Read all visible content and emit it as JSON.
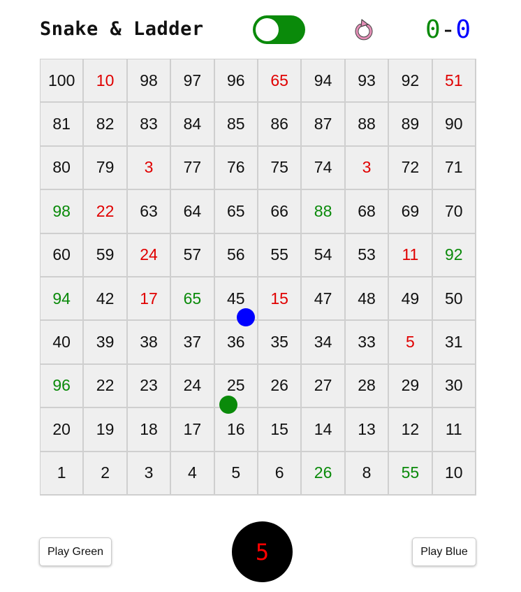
{
  "header": {
    "title": "Snake & Ladder",
    "toggle": {
      "state": "on",
      "color": "#0a8a0a"
    },
    "reset_icon": "refresh-icon",
    "score": {
      "green": "0",
      "separator": "-",
      "blue": "0"
    }
  },
  "colors": {
    "green": "#0a8a0a",
    "blue": "#0000ff",
    "snake": "#e00000",
    "dice_bg": "#000000",
    "dice_text": "#ff0000"
  },
  "board": {
    "rows": [
      [
        {
          "label": "100",
          "kind": "normal"
        },
        {
          "label": "10",
          "kind": "snake"
        },
        {
          "label": "98",
          "kind": "normal"
        },
        {
          "label": "97",
          "kind": "normal"
        },
        {
          "label": "96",
          "kind": "normal"
        },
        {
          "label": "65",
          "kind": "snake"
        },
        {
          "label": "94",
          "kind": "normal"
        },
        {
          "label": "93",
          "kind": "normal"
        },
        {
          "label": "92",
          "kind": "normal"
        },
        {
          "label": "51",
          "kind": "snake"
        }
      ],
      [
        {
          "label": "81",
          "kind": "normal"
        },
        {
          "label": "82",
          "kind": "normal"
        },
        {
          "label": "83",
          "kind": "normal"
        },
        {
          "label": "84",
          "kind": "normal"
        },
        {
          "label": "85",
          "kind": "normal"
        },
        {
          "label": "86",
          "kind": "normal"
        },
        {
          "label": "87",
          "kind": "normal"
        },
        {
          "label": "88",
          "kind": "normal"
        },
        {
          "label": "89",
          "kind": "normal"
        },
        {
          "label": "90",
          "kind": "normal"
        }
      ],
      [
        {
          "label": "80",
          "kind": "normal"
        },
        {
          "label": "79",
          "kind": "normal"
        },
        {
          "label": "3",
          "kind": "snake"
        },
        {
          "label": "77",
          "kind": "normal"
        },
        {
          "label": "76",
          "kind": "normal"
        },
        {
          "label": "75",
          "kind": "normal"
        },
        {
          "label": "74",
          "kind": "normal"
        },
        {
          "label": "3",
          "kind": "snake"
        },
        {
          "label": "72",
          "kind": "normal"
        },
        {
          "label": "71",
          "kind": "normal"
        }
      ],
      [
        {
          "label": "98",
          "kind": "ladder"
        },
        {
          "label": "22",
          "kind": "snake"
        },
        {
          "label": "63",
          "kind": "normal"
        },
        {
          "label": "64",
          "kind": "normal"
        },
        {
          "label": "65",
          "kind": "normal"
        },
        {
          "label": "66",
          "kind": "normal"
        },
        {
          "label": "88",
          "kind": "ladder"
        },
        {
          "label": "68",
          "kind": "normal"
        },
        {
          "label": "69",
          "kind": "normal"
        },
        {
          "label": "70",
          "kind": "normal"
        }
      ],
      [
        {
          "label": "60",
          "kind": "normal"
        },
        {
          "label": "59",
          "kind": "normal"
        },
        {
          "label": "24",
          "kind": "snake"
        },
        {
          "label": "57",
          "kind": "normal"
        },
        {
          "label": "56",
          "kind": "normal"
        },
        {
          "label": "55",
          "kind": "normal"
        },
        {
          "label": "54",
          "kind": "normal"
        },
        {
          "label": "53",
          "kind": "normal"
        },
        {
          "label": "11",
          "kind": "snake"
        },
        {
          "label": "92",
          "kind": "ladder"
        }
      ],
      [
        {
          "label": "94",
          "kind": "ladder"
        },
        {
          "label": "42",
          "kind": "normal"
        },
        {
          "label": "17",
          "kind": "snake"
        },
        {
          "label": "65",
          "kind": "ladder"
        },
        {
          "label": "45",
          "kind": "normal"
        },
        {
          "label": "15",
          "kind": "snake"
        },
        {
          "label": "47",
          "kind": "normal"
        },
        {
          "label": "48",
          "kind": "normal"
        },
        {
          "label": "49",
          "kind": "normal"
        },
        {
          "label": "50",
          "kind": "normal"
        }
      ],
      [
        {
          "label": "40",
          "kind": "normal"
        },
        {
          "label": "39",
          "kind": "normal"
        },
        {
          "label": "38",
          "kind": "normal"
        },
        {
          "label": "37",
          "kind": "normal"
        },
        {
          "label": "36",
          "kind": "normal"
        },
        {
          "label": "35",
          "kind": "normal"
        },
        {
          "label": "34",
          "kind": "normal"
        },
        {
          "label": "33",
          "kind": "normal"
        },
        {
          "label": "5",
          "kind": "snake"
        },
        {
          "label": "31",
          "kind": "normal"
        }
      ],
      [
        {
          "label": "96",
          "kind": "ladder"
        },
        {
          "label": "22",
          "kind": "normal"
        },
        {
          "label": "23",
          "kind": "normal"
        },
        {
          "label": "24",
          "kind": "normal"
        },
        {
          "label": "25",
          "kind": "normal"
        },
        {
          "label": "26",
          "kind": "normal"
        },
        {
          "label": "27",
          "kind": "normal"
        },
        {
          "label": "28",
          "kind": "normal"
        },
        {
          "label": "29",
          "kind": "normal"
        },
        {
          "label": "30",
          "kind": "normal"
        }
      ],
      [
        {
          "label": "20",
          "kind": "normal"
        },
        {
          "label": "19",
          "kind": "normal"
        },
        {
          "label": "18",
          "kind": "normal"
        },
        {
          "label": "17",
          "kind": "normal"
        },
        {
          "label": "16",
          "kind": "normal"
        },
        {
          "label": "15",
          "kind": "normal"
        },
        {
          "label": "14",
          "kind": "normal"
        },
        {
          "label": "13",
          "kind": "normal"
        },
        {
          "label": "12",
          "kind": "normal"
        },
        {
          "label": "11",
          "kind": "normal"
        }
      ],
      [
        {
          "label": "1",
          "kind": "normal"
        },
        {
          "label": "2",
          "kind": "normal"
        },
        {
          "label": "3",
          "kind": "normal"
        },
        {
          "label": "4",
          "kind": "normal"
        },
        {
          "label": "5",
          "kind": "normal"
        },
        {
          "label": "6",
          "kind": "normal"
        },
        {
          "label": "26",
          "kind": "ladder"
        },
        {
          "label": "8",
          "kind": "normal"
        },
        {
          "label": "55",
          "kind": "ladder"
        },
        {
          "label": "10",
          "kind": "normal"
        }
      ]
    ]
  },
  "tokens": {
    "blue": {
      "color": "#0000ff"
    },
    "green": {
      "color": "#0a8a0a"
    }
  },
  "controls": {
    "play_green_label": "Play Green",
    "dice_value": "5",
    "play_blue_label": "Play Blue"
  }
}
